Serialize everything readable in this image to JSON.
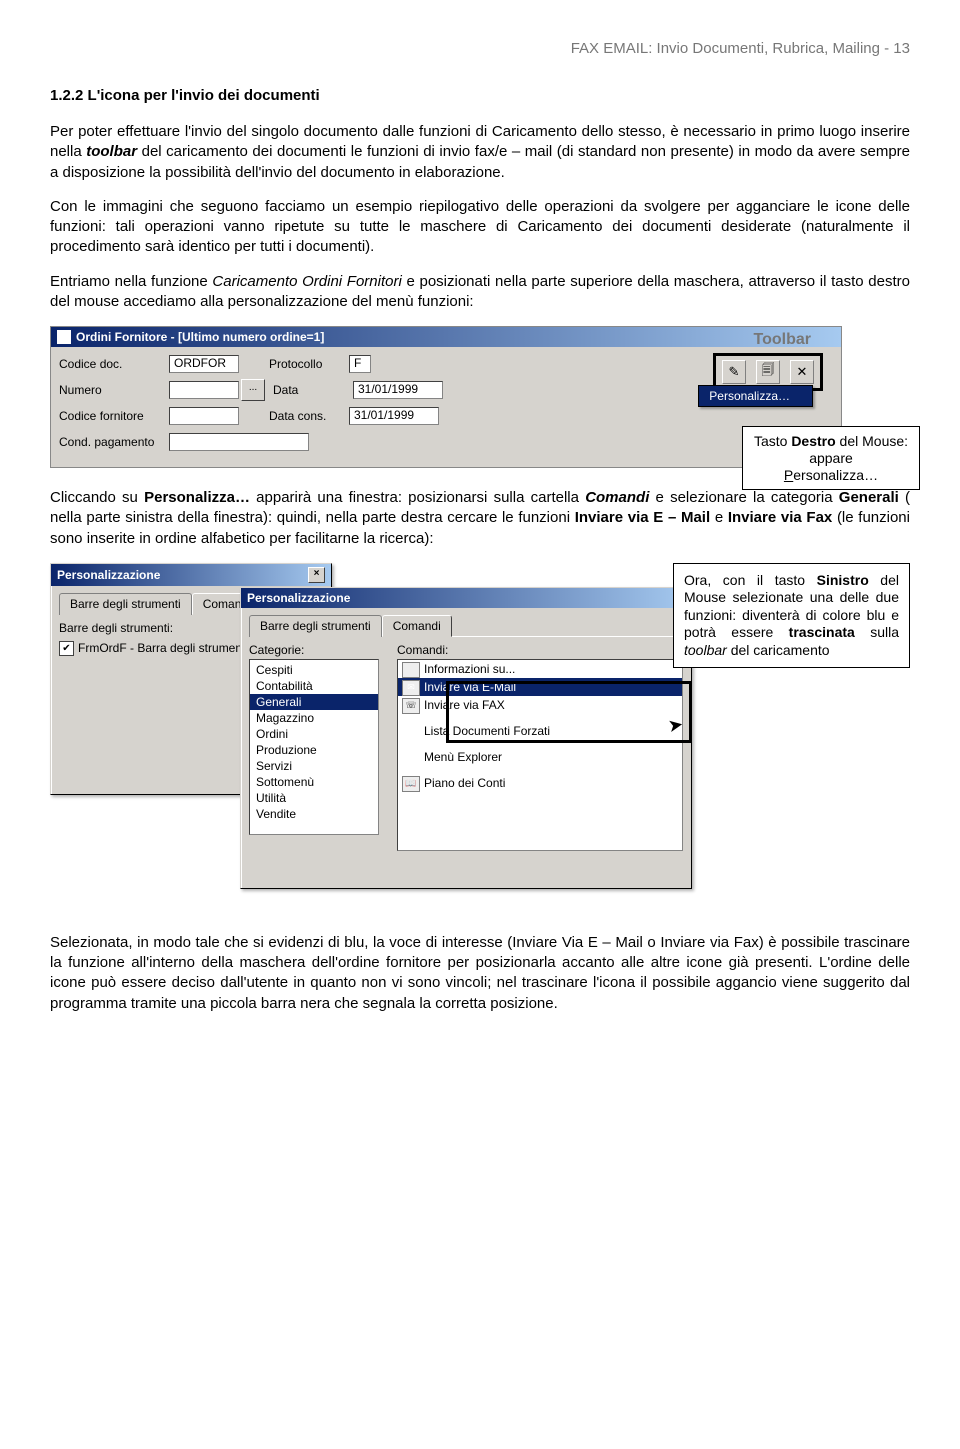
{
  "header": "FAX EMAIL: Invio Documenti, Rubrica, Mailing - 13",
  "section_title": "1.2.2  L'icona per l'invio dei documenti",
  "p1a": "Per poter effettuare l'invio del singolo documento dalle funzioni di Caricamento dello stesso, è necessario in primo luogo inserire nella ",
  "p1b_bolditalic": "toolbar",
  "p1c": " del caricamento dei documenti le funzioni di invio fax/e – mail (di standard non presente) in modo da avere sempre a disposizione la possibilità dell'invio del documento in elaborazione.",
  "p2": "Con le immagini che seguono facciamo un esempio riepilogativo delle operazioni da svolgere per agganciare le icone delle funzioni: tali operazioni vanno ripetute su tutte le maschere di Caricamento dei documenti desiderate  (naturalmente il procedimento sarà identico per tutti i documenti).",
  "p3a": "Entriamo nella funzione ",
  "p3b_italic": "Caricamento Ordini Fornitori",
  "p3c": " e posizionati nella parte superiore della maschera, attraverso il tasto destro del mouse accediamo alla personalizzazione del menù funzioni:",
  "shot1": {
    "title": "Ordini Fornitore - [Ultimo numero ordine=1]",
    "labels": {
      "codice_doc": "Codice doc.",
      "numero": "Numero",
      "codice_fornitore": "Codice fornitore",
      "cond_pagamento": "Cond. pagamento",
      "protocollo": "Protocollo",
      "data": "Data",
      "data_cons": "Data cons."
    },
    "values": {
      "codice_doc": "ORDFOR",
      "protocollo": "F",
      "data": "31/01/1999",
      "data_cons": "31/01/1999"
    },
    "toolbar_label": "Toolbar",
    "personalizza": "Personalizza…",
    "ellipsis": "..."
  },
  "callout1": {
    "l1a": "Tasto ",
    "l1b_bold": "Destro",
    "l1c": " del Mouse: appare ",
    "l2_under": "P",
    "l2_rest": "ersonalizza…"
  },
  "p4a": "Cliccando su ",
  "p4b_bold": "Personalizza…",
  "p4c": " apparirà una finestra: posizionarsi sulla cartella ",
  "p4d_bolditalic": "Comandi",
  "p4e": " e selezionare la categoria ",
  "p4f_bold": "Generali",
  "p4g": " ( nella parte sinistra della finestra): quindi, nella parte destra cercare le funzioni ",
  "p4h_bold": "Inviare via E – Mail",
  "p4i": " e ",
  "p4j_bold": "Inviare via Fax",
  "p4k": " (le funzioni sono inserite in ordine alfabetico per facilitarne la ricerca):",
  "shot2": {
    "win_title": "Personalizzazione",
    "tab_barre": "Barre degli strumenti",
    "tab_comandi": "Comandi",
    "lbl_barre": "Barre degli strumenti:",
    "cb_item": "FrmOrdF - Barra degli strumenti",
    "lbl_categorie": "Categorie:",
    "lbl_comandi": "Comandi:",
    "categories": [
      "Cespiti",
      "Contabilità",
      "Generali",
      "Magazzino",
      "Ordini",
      "Produzione",
      "Servizi",
      "Sottomenù",
      "Utilità",
      "Vendite"
    ],
    "commands": [
      "Informazioni su...",
      "Inviare via E-Mail",
      "Inviare via FAX",
      "Lista Documenti Forzati",
      "Menù Explorer",
      "Piano dei Conti"
    ],
    "close_x": "×"
  },
  "callout2": {
    "t1": "Ora, con il tasto ",
    "t2_bold": "Sinistro",
    "t3": " del Mouse selezionate una delle due funzioni: diventerà di colore blu e potrà essere ",
    "t4_bold": "trascinata",
    "t5": " sulla ",
    "t6_italic": "toolbar",
    "t7": " del caricamento"
  },
  "p5": "Selezionata, in modo tale che si evidenzi di blu, la voce di interesse (Inviare Via E – Mail o Inviare via Fax) è possibile trascinare la funzione all'interno della maschera dell'ordine fornitore per posizionarla accanto alle altre icone già presenti. L'ordine delle icone può essere deciso dall'utente in quanto non vi sono vincoli; nel trascinare l'icona il possibile aggancio viene suggerito dal programma tramite una piccola barra nera che segnala la corretta posizione."
}
